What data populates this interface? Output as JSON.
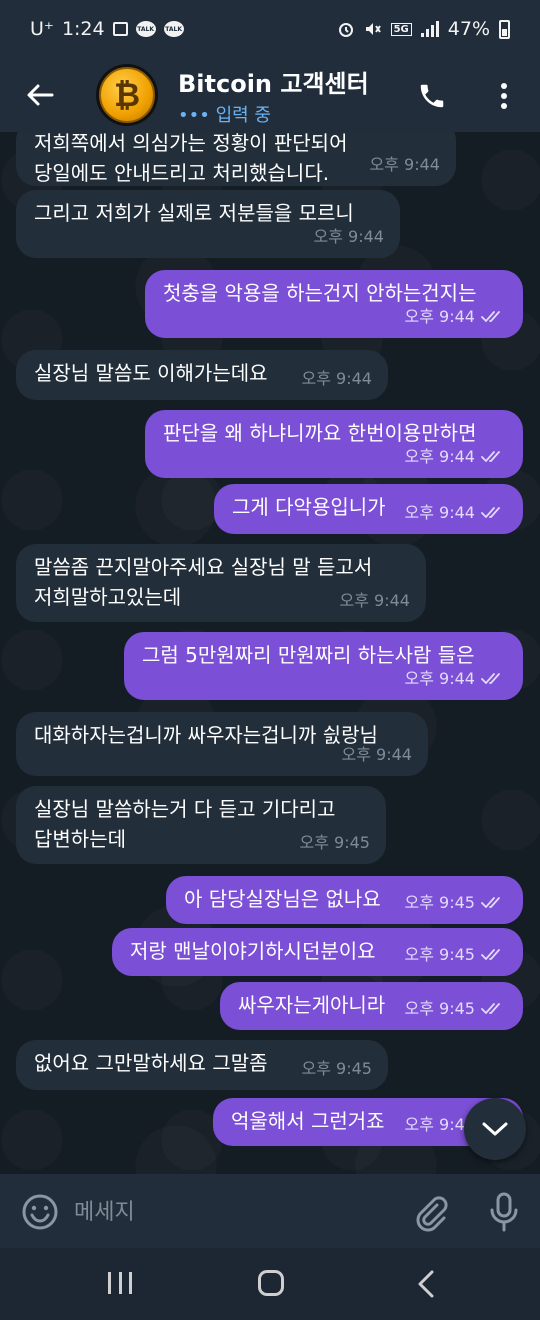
{
  "status_bar": {
    "carrier": "U⁺",
    "time": "1:24",
    "talk_label": "TALK",
    "network": "5G",
    "battery": "47%"
  },
  "header": {
    "title": "Bitcoin 고객센터",
    "status": "••• 입력 중",
    "avatar_symbol": "₿"
  },
  "messages": [
    {
      "dir": "in",
      "lines": [
        "저희쪽에서 의심가는 정황이 판단되어",
        "당일에도 안내드리고 처리했습니다."
      ],
      "time": "오후 9:44",
      "read": false
    },
    {
      "dir": "in",
      "lines": [
        "그리고 저희가 실제로 저분들을 모르니"
      ],
      "time": "오후 9:44",
      "read": false
    },
    {
      "dir": "out",
      "lines": [
        "첫충을 악용을 하는건지 안하는건지는"
      ],
      "time": "오후 9:44",
      "read": true
    },
    {
      "dir": "in",
      "lines": [
        "실장님 말씀도 이해가는데요"
      ],
      "time": "오후 9:44",
      "read": false
    },
    {
      "dir": "out",
      "lines": [
        "판단을 왜 하냐니까요 한번이용만하면"
      ],
      "time": "오후 9:44",
      "read": true
    },
    {
      "dir": "out",
      "lines": [
        "그게 다악용입니가"
      ],
      "time": "오후 9:44",
      "read": true
    },
    {
      "dir": "in",
      "lines": [
        "말씀좀 끈지말아주세요 실장님 말 듣고서",
        "저희말하고있는데"
      ],
      "time": "오후 9:44",
      "read": false
    },
    {
      "dir": "out",
      "lines": [
        "그럼 5만원짜리 만원짜리 하는사람 들은"
      ],
      "time": "오후 9:44",
      "read": true
    },
    {
      "dir": "in",
      "lines": [
        "대화하자는겁니까 싸우자는겁니까 싌랑님"
      ],
      "time": "오후 9:44",
      "read": false
    },
    {
      "dir": "in",
      "lines": [
        "실장님 말씀하는거 다 듣고 기다리고",
        "답변하는데"
      ],
      "time": "오후 9:45",
      "read": false
    },
    {
      "dir": "out",
      "lines": [
        "아 담당실장님은 없나요"
      ],
      "time": "오후 9:45",
      "read": true
    },
    {
      "dir": "out",
      "lines": [
        "저랑 맨날이야기하시던분이요"
      ],
      "time": "오후 9:45",
      "read": true
    },
    {
      "dir": "out",
      "lines": [
        "싸우자는게아니라"
      ],
      "time": "오후 9:45",
      "read": true
    },
    {
      "dir": "in",
      "lines": [
        "없어요 그만말하세요 그말좀"
      ],
      "time": "오후 9:45",
      "read": false
    },
    {
      "dir": "out",
      "lines": [
        "억울해서 그런거죠"
      ],
      "time": "오후 9:45",
      "read": true
    }
  ],
  "input": {
    "placeholder": "메세지"
  },
  "colors": {
    "bar": "#212d3b",
    "chat_bg": "#141c24",
    "incoming_bubble": "#222e3a",
    "outgoing_bubble": "#7b4fd6",
    "accent": "#6ab2f2"
  }
}
